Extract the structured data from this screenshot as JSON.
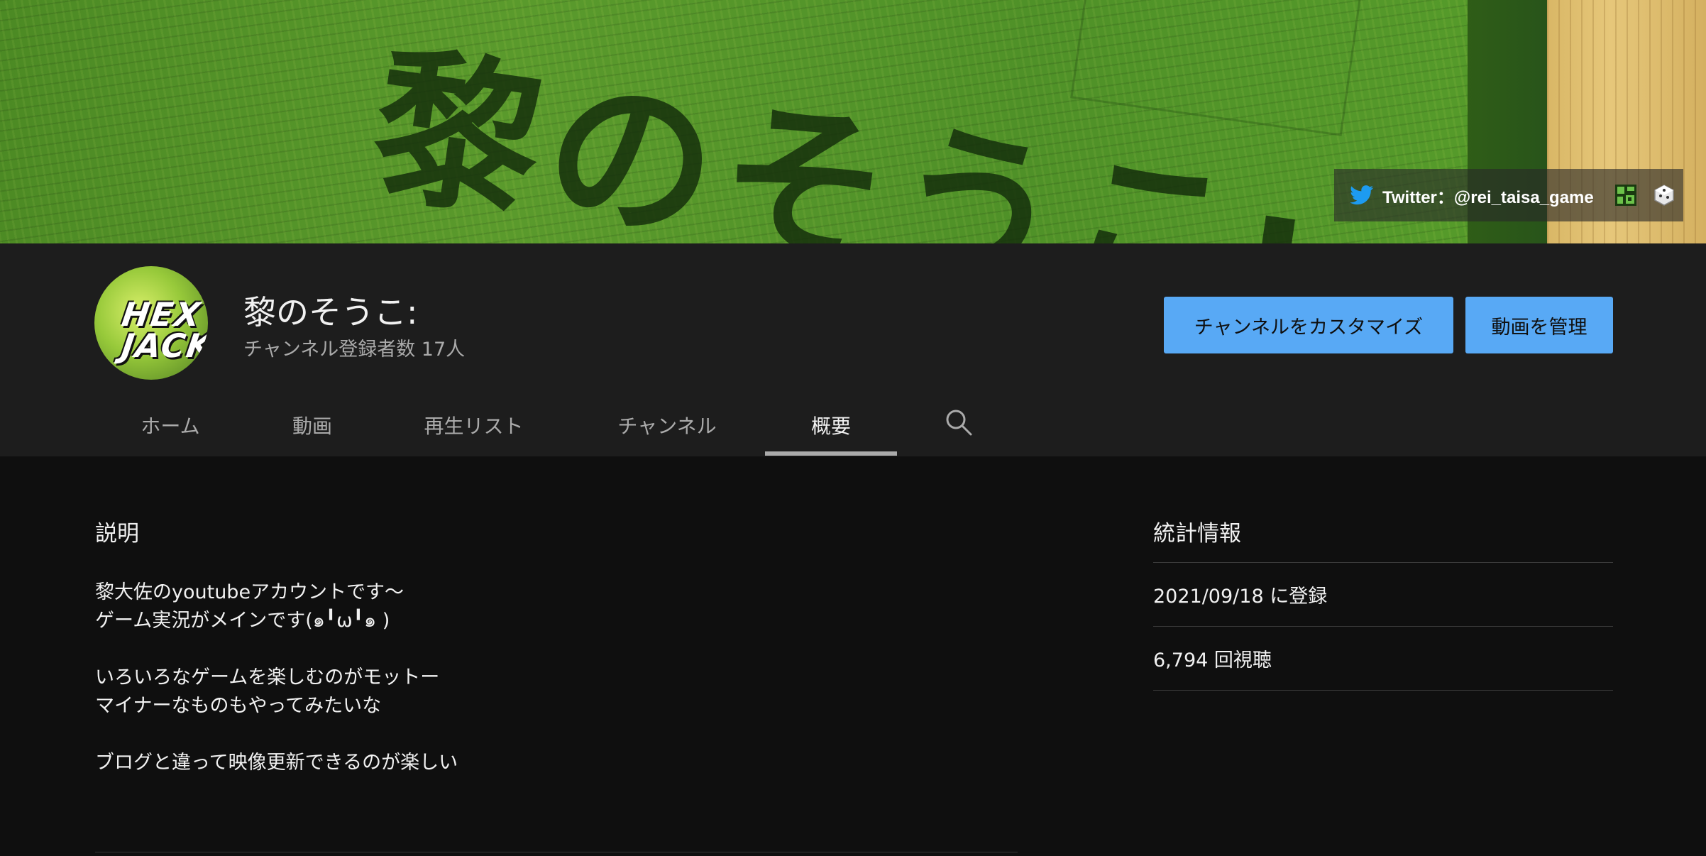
{
  "banner": {
    "title": "黎のそうこ:",
    "twitter_link": "Twitter：@rei_taisa_game",
    "icons": [
      "twitter-icon",
      "qr-link-icon",
      "dice-link-icon"
    ]
  },
  "channel": {
    "avatar_text_1": "HEX",
    "avatar_text_2": "JACK",
    "name": "黎のそうこ:",
    "subscribers": "チャンネル登録者数 17人"
  },
  "buttons": {
    "customize": "チャンネルをカスタマイズ",
    "manage": "動画を管理"
  },
  "tabs": [
    {
      "label": "ホーム"
    },
    {
      "label": "動画"
    },
    {
      "label": "再生リスト"
    },
    {
      "label": "チャンネル"
    },
    {
      "label": "概要",
      "active": true
    }
  ],
  "description": {
    "title": "説明",
    "lines": [
      "黎大佐のyoutubeアカウントです〜",
      "ゲーム実況がメインです(๑╹ω╹๑ )",
      "",
      "いろいろなゲームを楽しむのがモットー",
      "マイナーなものもやってみたいな",
      "",
      "ブログと違って映像更新できるのが楽しい"
    ]
  },
  "stats": {
    "title": "統計情報",
    "joined": "2021/09/18 に登録",
    "views": "6,794 回視聴"
  },
  "colors": {
    "accent_button": "#58a9f5",
    "page_bg": "#0f0f0f",
    "header_bg": "#1d1d1d",
    "twitter_blue": "#1d9bf0"
  }
}
